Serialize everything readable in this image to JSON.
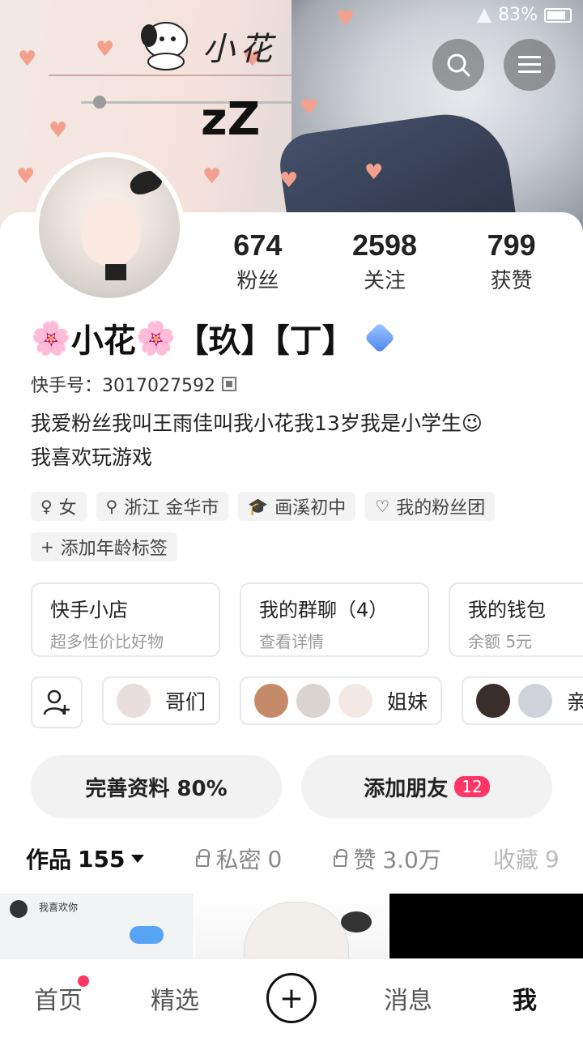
{
  "status_bar": {
    "battery": "83%"
  },
  "banner": {
    "title": "小花",
    "zz": "zZ"
  },
  "stats": [
    {
      "value": "674",
      "label": "粉丝"
    },
    {
      "value": "2598",
      "label": "关注"
    },
    {
      "value": "799",
      "label": "获赞"
    }
  ],
  "profile": {
    "name_part1": "小花",
    "name_part2": "【玖】【丁】",
    "kuaishou_id": "快手号：3017027592",
    "bio_line1": "我爱粉丝我叫王雨佳叫我小花我13岁我是小学生😉",
    "bio_line2": "我喜欢玩游戏"
  },
  "tags": [
    {
      "icon": "gender-female-icon",
      "glyph": "♀",
      "label": "女"
    },
    {
      "icon": "location-pin-icon",
      "glyph": "⚲",
      "label": "浙江 金华市"
    },
    {
      "icon": "school-cap-icon",
      "glyph": "🎓",
      "label": "画溪初中"
    },
    {
      "icon": "heart-outline-icon",
      "glyph": "♡",
      "label": "我的粉丝团"
    },
    {
      "icon": "plus-icon",
      "glyph": "+",
      "label": "添加年龄标签"
    }
  ],
  "cards": [
    {
      "title": "快手小店",
      "sub": "超多性价比好物"
    },
    {
      "title": "我的群聊（4）",
      "sub": "查看详情"
    },
    {
      "title": "我的钱包",
      "sub": "余额 5元"
    }
  ],
  "groups": [
    {
      "label": "哥们",
      "avatars": [
        "#e9dede"
      ]
    },
    {
      "label": "姐妹",
      "avatars": [
        "#c48a6a",
        "#d9d4d0",
        "#f3e8e4"
      ]
    },
    {
      "label": "亲密",
      "avatars": [
        "#3a2e2a",
        "#cfd2d8"
      ]
    }
  ],
  "actions": {
    "complete_profile": "完善资料 80%",
    "add_friends": "添加朋友",
    "add_friends_badge": "12"
  },
  "tabs": [
    {
      "label": "作品",
      "count": "155"
    },
    {
      "label": "私密",
      "count": "0"
    },
    {
      "label": "赞",
      "count": "3.0万"
    },
    {
      "label": "收藏",
      "count": "9"
    }
  ],
  "grid": {
    "chat_text": "我喜欢你"
  },
  "bottom_nav": [
    {
      "label": "首页"
    },
    {
      "label": "精选"
    },
    {
      "label": "+"
    },
    {
      "label": "消息"
    },
    {
      "label": "我"
    }
  ],
  "colors": {
    "accent": "#fe3666",
    "heart": "#f3a08f"
  }
}
